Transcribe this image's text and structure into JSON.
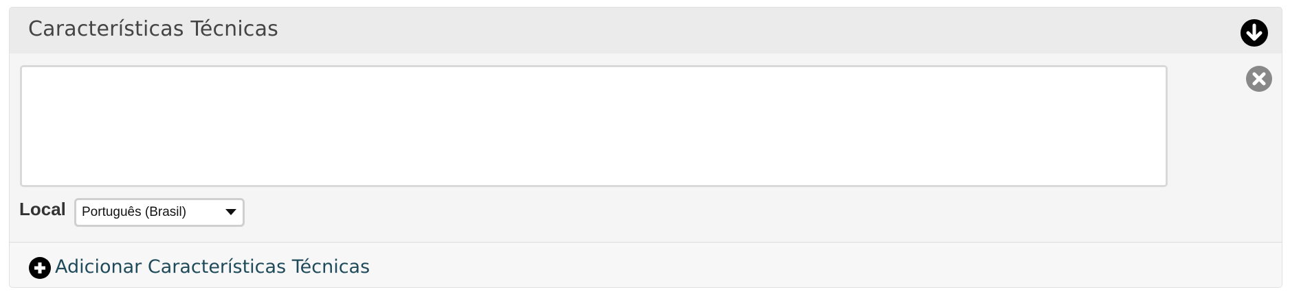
{
  "panel": {
    "title": "Características Técnicas"
  },
  "editor": {
    "text_value": "",
    "local_label": "Local",
    "locale_selected": "Português (Brasil)"
  },
  "footer": {
    "add_label": "Adicionar Características Técnicas"
  },
  "icons": {
    "collapse": "arrow-down-circle-icon",
    "remove": "close-circle-icon",
    "add": "plus-circle-icon"
  },
  "colors": {
    "title": "#444444",
    "link": "#1f4a5a",
    "remove_icon": "#888888"
  }
}
